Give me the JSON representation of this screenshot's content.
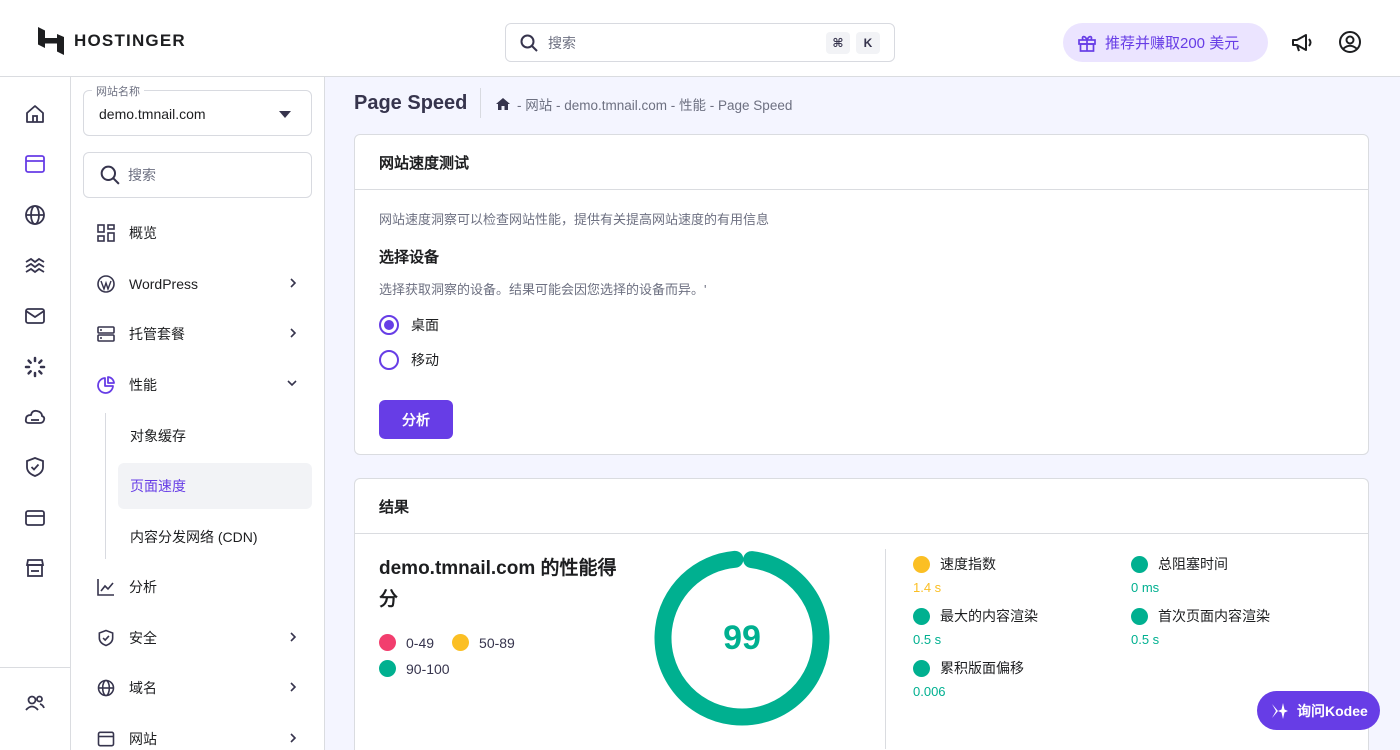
{
  "header": {
    "logo_text": "HOSTINGER",
    "search_placeholder": "搜索",
    "shortcut_keys": [
      "⌘",
      "K"
    ],
    "refer_label": "推荐并赚取200 美元"
  },
  "rail": {
    "icons": [
      "home-icon",
      "website-icon",
      "globe-icon",
      "hosting-icon",
      "email-icon",
      "loading-icon",
      "cloud-icon",
      "shield-icon",
      "billing-icon",
      "store-icon",
      "users-icon"
    ]
  },
  "sidebar": {
    "site_select_label": "网站名称",
    "site_select_value": "demo.tmnail.com",
    "search_placeholder": "搜索",
    "items": [
      {
        "label": "概览"
      },
      {
        "label": "WordPress"
      },
      {
        "label": "托管套餐"
      },
      {
        "label": "性能"
      },
      {
        "label": "分析"
      },
      {
        "label": "安全"
      },
      {
        "label": "域名"
      },
      {
        "label": "网站"
      }
    ],
    "subitems": [
      {
        "label": "对象缓存"
      },
      {
        "label": "页面速度"
      },
      {
        "label": "内容分发网络 (CDN)"
      }
    ]
  },
  "main": {
    "title": "Page Speed",
    "breadcrumb": "- 网站 - demo.tmnail.com - 性能 - Page Speed",
    "speed_test": {
      "heading": "网站速度测试",
      "description": "网站速度洞察可以检查网站性能，提供有关提高网站速度的有用信息",
      "device_heading": "选择设备",
      "device_description": "选择获取洞察的设备。结果可能会因您选择的设备而异。'",
      "options": [
        "桌面",
        "移动"
      ],
      "selected": "桌面",
      "analyze_label": "分析"
    },
    "results": {
      "heading": "结果",
      "score_title": "demo.tmnail.com 的性能得分",
      "legend": [
        {
          "label": "0-49",
          "color": "#f23e6e"
        },
        {
          "label": "50-89",
          "color": "#fbbf24"
        },
        {
          "label": "90-100",
          "color": "#00b090"
        }
      ],
      "score": "99",
      "score_fraction": 0.99,
      "metrics": [
        {
          "label": "速度指数",
          "value": "1.4 s",
          "color": "#fbbf24"
        },
        {
          "label": "总阻塞时间",
          "value": "0 ms",
          "color": "#00b090"
        },
        {
          "label": "最大的内容渲染",
          "value": "0.5 s",
          "color": "#00b090"
        },
        {
          "label": "首次页面内容渲染",
          "value": "0.5 s",
          "color": "#00b090"
        },
        {
          "label": "累积版面偏移",
          "value": "0.006",
          "color": "#00b090"
        }
      ]
    }
  },
  "kodee_label": "询问Kodee",
  "colors": {
    "accent": "#673de6",
    "good": "#00b090",
    "warn": "#fbbf24",
    "bad": "#f23e6e"
  }
}
